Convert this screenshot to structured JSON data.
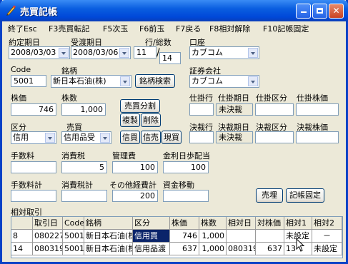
{
  "window": {
    "title": "売買記帳"
  },
  "menu": [
    "終了Esc",
    "F3売買転記",
    "F5次玉",
    "F6前玉",
    "F7戻る",
    "F8相対解除",
    "F10記帳固定"
  ],
  "form": {
    "contract_date_label": "約定期日",
    "contract_date": "2008/03/03",
    "delivery_date_label": "受渡期日",
    "delivery_date": "2008/03/06",
    "line_label": "行/総数",
    "line_value": "11",
    "total_value": "14",
    "account_label": "口座",
    "account": "カブコム",
    "code_label": "Code",
    "code": "5001",
    "stock_label": "銘柄",
    "stock": "新日本石油(株)",
    "stock_search": "銘柄検索",
    "broker_label": "証券会社",
    "broker": "カブコム",
    "price_label": "株価",
    "price": "746",
    "shares_label": "株数",
    "shares": "1,000",
    "split_btn": "売買分割",
    "copy_btn": "複製",
    "delete_btn": "削除",
    "pending_row_label": "仕掛行",
    "pending_date_label": "仕掛期日",
    "pending_kind_label": "仕掛区分",
    "pending_price_label": "仕掛株価",
    "pending_date_value": "未決裁",
    "kind_label": "区分",
    "kind": "信用",
    "trade_label": "売買",
    "trade": "信用品受",
    "buy_btn": "信買",
    "sell_btn": "信売",
    "spot_buy_btn": "現買",
    "settle_row_label": "決裁行",
    "settle_date_label": "決裁期日",
    "settle_kind_label": "決裁区分",
    "settle_price_label": "決裁株価",
    "settle_date_value": "未決裁",
    "fee_label": "手数料",
    "fee": "",
    "tax_label": "消費税",
    "tax": "5",
    "mgmt_label": "管理費",
    "mgmt": "100",
    "interest_label": "金利日歩配当",
    "interest": "100",
    "fee_total_label": "手数料計",
    "fee_total": "",
    "tax_total_label": "消費税計",
    "tax_total": "",
    "other_label": "その他経費計",
    "other": "200",
    "cash_label": "資金移動",
    "cash": "",
    "sell_entry_btn": "売埋",
    "fix_btn": "記帳固定"
  },
  "table": {
    "title": "相対取引",
    "headers": [
      "",
      "取引日",
      "Code",
      "銘柄",
      "区分",
      "株価",
      "株数",
      "相対日",
      "対株価",
      "相対1",
      "相対2"
    ],
    "rows": [
      [
        "8",
        "080227",
        "5001",
        "新日本石油(株)",
        "信用買",
        "746",
        "1,000",
        "",
        "",
        "未設定",
        "－"
      ],
      [
        "14",
        "080319",
        "5001",
        "新日本石油(株)",
        "信用品渡",
        "637",
        "1,000",
        "080319",
        "637",
        "13",
        "未設定"
      ]
    ]
  }
}
